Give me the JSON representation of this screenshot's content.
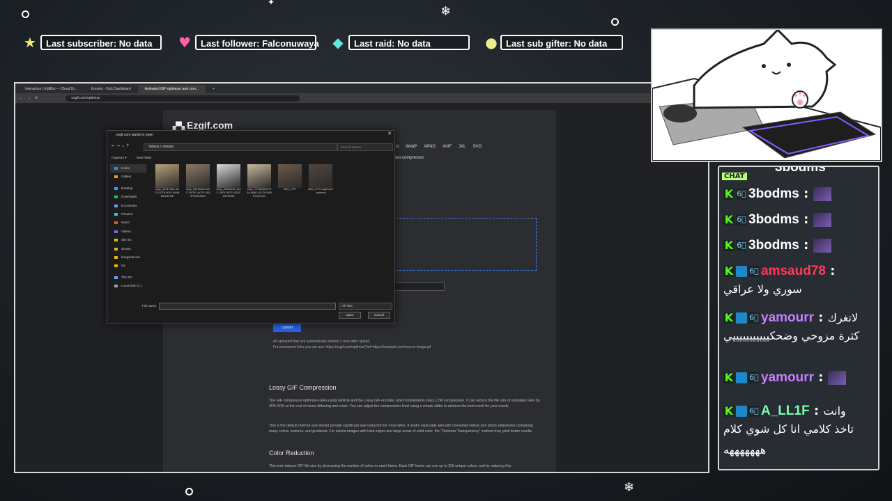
{
  "overlay": {
    "stats": [
      {
        "icon": "star-icon",
        "glyph": "★",
        "color": "#f4e97a",
        "label": "Last subscriber: No data"
      },
      {
        "icon": "heart-icon",
        "glyph": "♥",
        "color": "#ff5fa8",
        "label": "Last follower: Falconuwaya"
      },
      {
        "icon": "diamond-icon",
        "glyph": "◆",
        "color": "#5fe8e0",
        "label": "Last raid: No data"
      },
      {
        "icon": "coin-icon",
        "glyph": "●",
        "color": "#e8f08a",
        "label": "Last sub gifter: No data"
      }
    ]
  },
  "browser": {
    "tabs": [
      "Interaction | EditBot — Cloud Dr...",
      "Emotes - Kick Dashboard",
      "Animated GIF optimizer and com...",
      "+"
    ],
    "url": "ezgif.com/optimize",
    "page": {
      "logo": "Ezgif.com",
      "nav": [
        "ext",
        "WebP",
        "APNG",
        "AVIF",
        "JXL",
        "SVG"
      ],
      "nav_tail": "ideo compressor",
      "upload_label": "Upload",
      "note1": "All uploaded files are automatically deleted 1 hour after upload.",
      "note2": "For permanent links you can use: https://ezgif.com/optimize?url=https://example.com/source-image.gif",
      "h1": "Lossy GIF Compression",
      "p1": "The GIF compressor optimizes GIFs using Gifsicle and the Lossy GIF encoder, which implements lossy LZW compression. It can reduce the file size of animated GIFs by 30%-50% at the cost of some dithering and noise. You can adjust the compression level using a simple slider to achieve the best result for your needs.",
      "p2": "This is the default method and should provide significant size reduction for most GIFs. It works especially well with converted videos and photo slideshows containing many colors, textures, and gradients. For simple images with hard edges and large areas of solid color, the \"Optimize Transparency\" method may yield better results.",
      "h2": "Color Reduction",
      "p3": "This tool reduces GIF file size by decreasing the number of colors in each frame. Each GIF frame can use up to 256 unique colors, and by reducing this"
    }
  },
  "dialog": {
    "title": "ezgif.com wants to open",
    "path": "Videos  >  stream",
    "search_placeholder": "Search stream",
    "organize": "Organize ▾",
    "new_folder": "New folder",
    "sidebar": [
      "Home",
      "Gallery",
      "Desktop",
      "Downloads",
      "Documents",
      "Pictures",
      "Music",
      "Videos",
      "obs rec",
      "stream",
      "bongocat-osu",
      "rec",
      "This PC",
      "Local Disk (C:)"
    ],
    "files": [
      {
        "name": "copy_404475AC-4DF3-407B-9047-5A4BB43367DB"
      },
      {
        "name": "copy_80E3810C-0D17-4FDC-ACFE-4939F5CBCBB4"
      },
      {
        "name": "copy_2634004D-142C-44F3-9F27-8115CD8F8CB5"
      },
      {
        "name": "copy_FFC8D300-FE04-4A6D-8CC5-5383E7047D01"
      },
      {
        "name": "IMG_1797"
      },
      {
        "name": "IMG_1797-ezgif.com-optimize"
      }
    ],
    "filename_label": "File name:",
    "filter": "All Files",
    "open": "Open",
    "cancel": "Cancel"
  },
  "chat": {
    "messages": [
      {
        "user": "3bodms",
        "color": "#ffffff",
        "badges": [
          "k",
          "g"
        ],
        "emote": true,
        "text": ""
      },
      {
        "user": "3bodms",
        "color": "#ffffff",
        "badges": [
          "k",
          "g"
        ],
        "emote": true,
        "text": ""
      },
      {
        "user": "3bodms",
        "color": "#ffffff",
        "badges": [
          "k",
          "g"
        ],
        "emote": true,
        "text": ""
      },
      {
        "user": "amsaud78",
        "color": "#ff3b5c",
        "badges": [
          "k",
          "s",
          "g"
        ],
        "emote": false,
        "text": "سوري ولا عراقي"
      },
      {
        "user": "yamourr",
        "color": "#c77dff",
        "badges": [
          "k",
          "s",
          "g"
        ],
        "emote": false,
        "prefix": "لاتغرك",
        "text": "كثرة مزوحي وضحكيييييييييييي"
      },
      {
        "user": "yamourr",
        "color": "#c77dff",
        "badges": [
          "k",
          "s",
          "g"
        ],
        "emote": true,
        "text": ""
      },
      {
        "user": "A_LL1F",
        "color": "#7dffb0",
        "badges": [
          "k",
          "s",
          "g"
        ],
        "emote": false,
        "prefix": "وانت",
        "text": "تاخذ كلامي انا كل شوي كلام هههههههه"
      }
    ],
    "top_partial": "3bodms",
    "chat_tag": "CHAT"
  }
}
